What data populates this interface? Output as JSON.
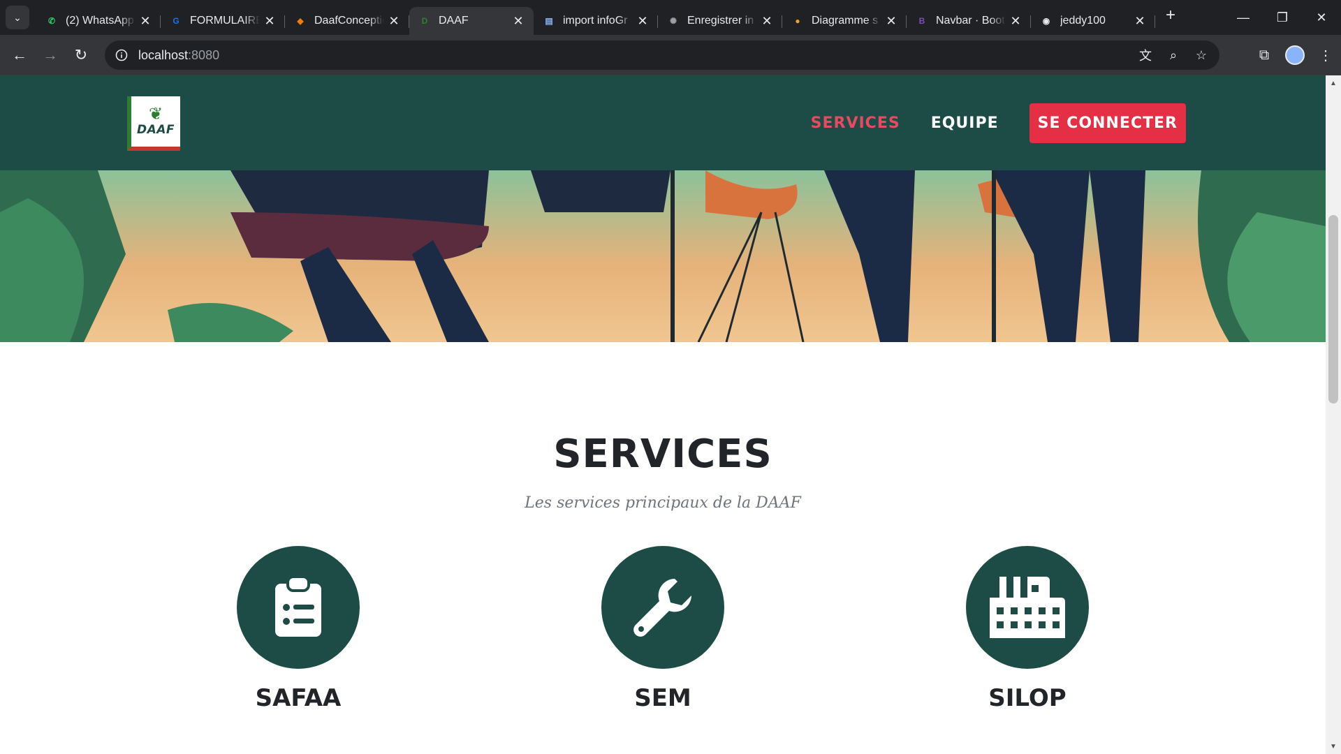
{
  "browser": {
    "tabs": [
      {
        "title": "(2) WhatsApp",
        "favicon": "whatsapp-icon",
        "color": "#25d366",
        "glyph": "✆"
      },
      {
        "title": "FORMULAIRE",
        "favicon": "forms-icon",
        "color": "#1a73e8",
        "glyph": "G"
      },
      {
        "title": "DaafConception",
        "favicon": "draw-icon",
        "color": "#f57c00",
        "glyph": "◆"
      },
      {
        "title": "DAAF",
        "favicon": "daaf-icon",
        "color": "#2e7d32",
        "glyph": "D",
        "active": true
      },
      {
        "title": "import infoGr",
        "favicon": "book-icon",
        "color": "#8ab4f8",
        "glyph": "▤"
      },
      {
        "title": "Enregistrer in",
        "favicon": "openai-icon",
        "color": "#9aa0a6",
        "glyph": "✺"
      },
      {
        "title": "Diagramme s",
        "favicon": "diagram-icon",
        "color": "#f4a020",
        "glyph": "●"
      },
      {
        "title": "Navbar · Boot",
        "favicon": "bootstrap-icon",
        "color": "#7952b3",
        "glyph": "B"
      },
      {
        "title": "jeddy100",
        "favicon": "github-icon",
        "color": "#e8eaed",
        "glyph": "◉"
      }
    ],
    "address": {
      "host": "localhost",
      "port": ":8080"
    }
  },
  "site": {
    "logo_text": "DAAF",
    "nav": {
      "services": "SERVICES",
      "equipe": "EQUIPE",
      "login": "SE CONNECTER"
    },
    "accent_color": "#e42f45",
    "primary_color": "#1d4c47"
  },
  "services": {
    "title": "SERVICES",
    "subtitle": "Les services principaux de la DAAF",
    "items": [
      {
        "name": "SAFAA",
        "icon": "clipboard-list-icon"
      },
      {
        "name": "SEM",
        "icon": "wrench-icon"
      },
      {
        "name": "SILOP",
        "icon": "industry-icon"
      }
    ]
  }
}
